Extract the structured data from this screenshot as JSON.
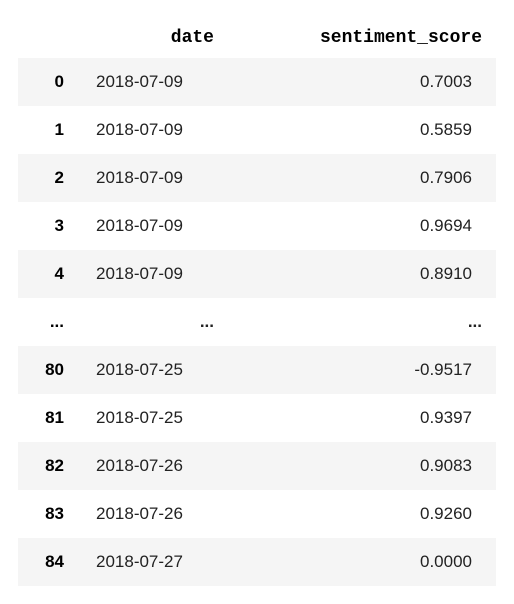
{
  "columns": {
    "index": "",
    "date": "date",
    "sentiment_score": "sentiment_score"
  },
  "rows": [
    {
      "idx": "0",
      "date": "2018-07-09",
      "score": "0.7003"
    },
    {
      "idx": "1",
      "date": "2018-07-09",
      "score": "0.5859"
    },
    {
      "idx": "2",
      "date": "2018-07-09",
      "score": "0.7906"
    },
    {
      "idx": "3",
      "date": "2018-07-09",
      "score": "0.9694"
    },
    {
      "idx": "4",
      "date": "2018-07-09",
      "score": "0.8910"
    },
    {
      "idx": "...",
      "date": "...",
      "score": "...",
      "ellipsis": true
    },
    {
      "idx": "80",
      "date": "2018-07-25",
      "score": "-0.9517"
    },
    {
      "idx": "81",
      "date": "2018-07-25",
      "score": "0.9397"
    },
    {
      "idx": "82",
      "date": "2018-07-26",
      "score": "0.9083"
    },
    {
      "idx": "83",
      "date": "2018-07-26",
      "score": "0.9260"
    },
    {
      "idx": "84",
      "date": "2018-07-27",
      "score": "0.0000"
    }
  ]
}
